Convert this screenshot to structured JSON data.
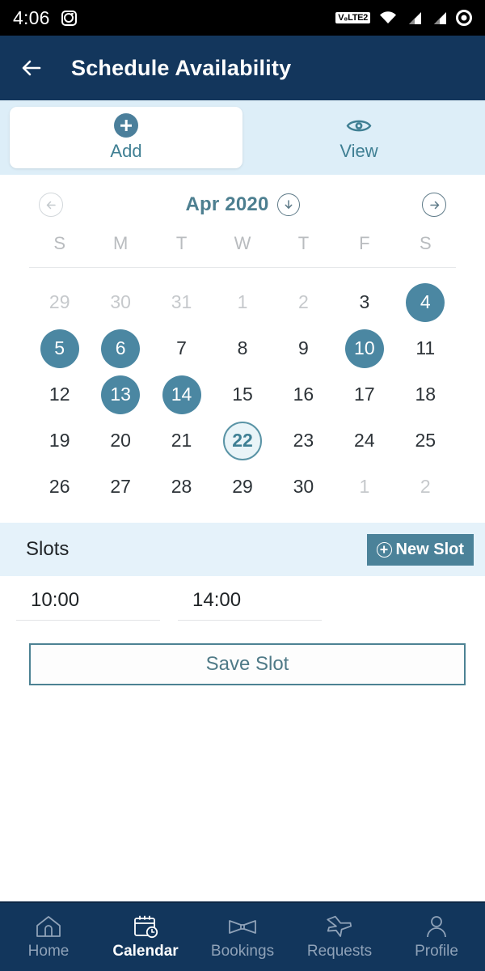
{
  "status_bar": {
    "time": "4:06",
    "icons": [
      "instagram-icon",
      "volte-badge",
      "wifi-icon",
      "signal-icon",
      "signal-icon",
      "record-icon"
    ],
    "volte_label": "V₈LTE2"
  },
  "app_bar": {
    "back_icon": "back-arrow-icon",
    "title": "Schedule Availability"
  },
  "tabs": [
    {
      "label": "Add",
      "icon": "plus-circle-icon",
      "active": true
    },
    {
      "label": "View",
      "icon": "eye-icon",
      "active": false
    }
  ],
  "calendar": {
    "prev_icon": "arrow-left-circle-icon",
    "next_icon": "arrow-right-circle-icon",
    "dropdown_icon": "arrow-down-circle-icon",
    "month_label": "Apr 2020",
    "weekdays": [
      "S",
      "M",
      "T",
      "W",
      "T",
      "F",
      "S"
    ],
    "days": [
      {
        "n": "29",
        "state": "muted"
      },
      {
        "n": "30",
        "state": "muted"
      },
      {
        "n": "31",
        "state": "muted"
      },
      {
        "n": "1",
        "state": "muted"
      },
      {
        "n": "2",
        "state": "muted"
      },
      {
        "n": "3",
        "state": "normal"
      },
      {
        "n": "4",
        "state": "marked"
      },
      {
        "n": "5",
        "state": "marked"
      },
      {
        "n": "6",
        "state": "marked"
      },
      {
        "n": "7",
        "state": "normal"
      },
      {
        "n": "8",
        "state": "normal"
      },
      {
        "n": "9",
        "state": "normal"
      },
      {
        "n": "10",
        "state": "marked"
      },
      {
        "n": "11",
        "state": "normal"
      },
      {
        "n": "12",
        "state": "normal"
      },
      {
        "n": "13",
        "state": "marked"
      },
      {
        "n": "14",
        "state": "marked"
      },
      {
        "n": "15",
        "state": "normal"
      },
      {
        "n": "16",
        "state": "normal"
      },
      {
        "n": "17",
        "state": "normal"
      },
      {
        "n": "18",
        "state": "normal"
      },
      {
        "n": "19",
        "state": "normal"
      },
      {
        "n": "20",
        "state": "normal"
      },
      {
        "n": "21",
        "state": "normal"
      },
      {
        "n": "22",
        "state": "today"
      },
      {
        "n": "23",
        "state": "normal"
      },
      {
        "n": "24",
        "state": "normal"
      },
      {
        "n": "25",
        "state": "normal"
      },
      {
        "n": "26",
        "state": "normal"
      },
      {
        "n": "27",
        "state": "normal"
      },
      {
        "n": "28",
        "state": "normal"
      },
      {
        "n": "29",
        "state": "normal"
      },
      {
        "n": "30",
        "state": "normal"
      },
      {
        "n": "1",
        "state": "muted"
      },
      {
        "n": "2",
        "state": "muted"
      }
    ]
  },
  "slots": {
    "title": "Slots",
    "new_slot_label": "New Slot",
    "new_slot_icon": "plus-circle-outline-icon",
    "start_time": "10:00",
    "end_time": "14:00",
    "save_label": "Save Slot"
  },
  "bottom_nav": [
    {
      "label": "Home",
      "icon": "home-icon",
      "active": false
    },
    {
      "label": "Calendar",
      "icon": "calendar-clock-icon",
      "active": true
    },
    {
      "label": "Bookings",
      "icon": "bowtie-icon",
      "active": false
    },
    {
      "label": "Requests",
      "icon": "airplane-icon",
      "active": false
    },
    {
      "label": "Profile",
      "icon": "person-icon",
      "active": false
    }
  ],
  "colors": {
    "header_navy": "#13365c",
    "accent_teal": "#4b87a2",
    "tab_strip_bg": "#ddeef8",
    "slots_bg": "#e5f2fa",
    "today_fill": "#e9f4f8"
  }
}
